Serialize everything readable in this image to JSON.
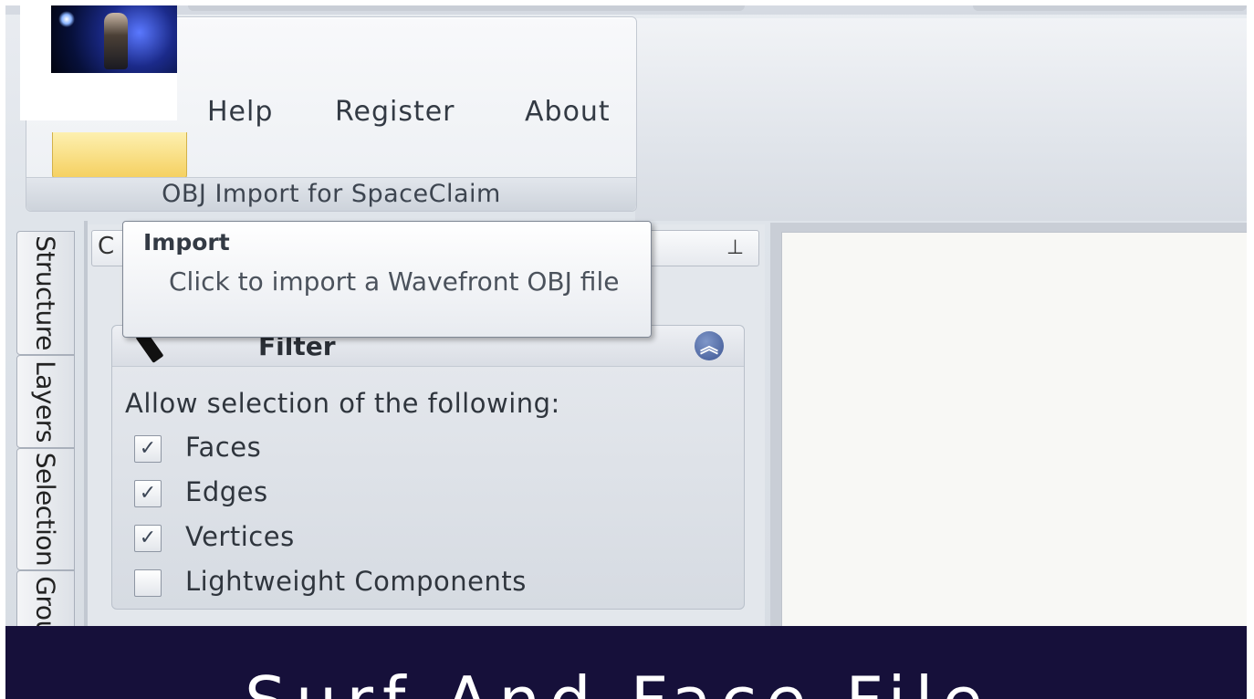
{
  "ribbon": {
    "menu": [
      "Help",
      "Register",
      "About"
    ],
    "group_label": "OBJ Import for SpaceClaim"
  },
  "side_tabs": [
    "Structure",
    "Layers",
    "Selection",
    "Grou"
  ],
  "panel": {
    "header_char": "C",
    "filter": {
      "title": "Filter",
      "allow_label": "Allow selection of the following:",
      "options": [
        {
          "label": "Faces",
          "checked": true
        },
        {
          "label": "Edges",
          "checked": true
        },
        {
          "label": "Vertices",
          "checked": true
        },
        {
          "label": "Lightweight Components",
          "checked": false
        }
      ]
    }
  },
  "tooltip": {
    "title": "Import",
    "body": "Click to import a Wavefront OBJ file"
  },
  "caption": {
    "text": "Surf And Face File"
  },
  "icons": {
    "pin": "pin-icon",
    "collapse": "double-chevron-up-icon",
    "filter": "filter-cursor-icon"
  }
}
